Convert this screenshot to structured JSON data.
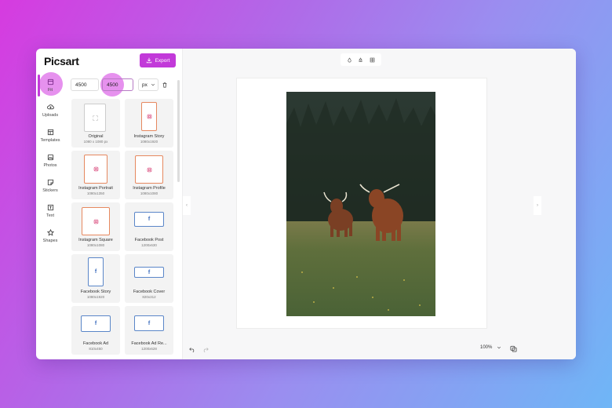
{
  "app": {
    "logo": "Picsart"
  },
  "header": {
    "export_label": "Export"
  },
  "rail": {
    "items": [
      {
        "label": "Fit",
        "icon": "fit-icon",
        "active": true
      },
      {
        "label": "Uploads",
        "icon": "upload-icon"
      },
      {
        "label": "Templates",
        "icon": "templates-icon"
      },
      {
        "label": "Photos",
        "icon": "photos-icon"
      },
      {
        "label": "Stickers",
        "icon": "stickers-icon"
      },
      {
        "label": "Text",
        "icon": "text-icon"
      },
      {
        "label": "Shapes",
        "icon": "shapes-icon"
      }
    ]
  },
  "size": {
    "width": "4500",
    "height": "4500",
    "unit": "px"
  },
  "presets": [
    {
      "label": "Original",
      "sub": "1080 x 1080 px",
      "kind": "orig"
    },
    {
      "label": "Instagram Story",
      "sub": "1080x1920",
      "kind": "ig"
    },
    {
      "label": "Instagram Portrait",
      "sub": "1080x1350",
      "kind": "ig"
    },
    {
      "label": "Instagram Profile",
      "sub": "1080x1080",
      "kind": "ig"
    },
    {
      "label": "Instagram Square",
      "sub": "1080x1080",
      "kind": "ig"
    },
    {
      "label": "Facebook Post",
      "sub": "1200x630",
      "kind": "fb"
    },
    {
      "label": "Facebook Story",
      "sub": "1080x1920",
      "kind": "fb"
    },
    {
      "label": "Facebook Cover",
      "sub": "820x312",
      "kind": "fb"
    },
    {
      "label": "Facebook Ad",
      "sub": "810x450",
      "kind": "fb"
    },
    {
      "label": "Facebook Ad Re...",
      "sub": "1200x628",
      "kind": "fb"
    }
  ],
  "canvas": {
    "zoom": "100%"
  },
  "colors": {
    "accent": "#c23ad9",
    "highlight": "#e691ee"
  }
}
